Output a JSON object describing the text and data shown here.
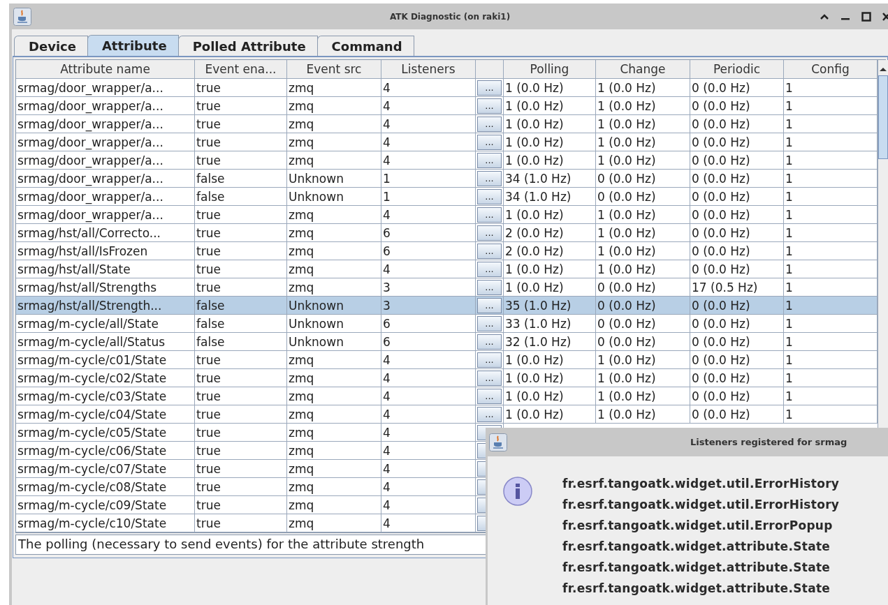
{
  "window": {
    "title": "ATK Diagnostic (on raki1)"
  },
  "tabs": [
    {
      "label": "Device",
      "selected": false
    },
    {
      "label": "Attribute",
      "selected": true
    },
    {
      "label": "Polled Attribute",
      "selected": false
    },
    {
      "label": "Command",
      "selected": false
    }
  ],
  "table": {
    "columns": [
      "Attribute name",
      "Event ena...",
      "Event src",
      "Listeners"
    ],
    "stat_columns": [
      "Polling",
      "Change",
      "Periodic",
      "Config"
    ],
    "rows": [
      {
        "cells": [
          "srmag/door_wrapper/a...",
          "true",
          "zmq",
          "4"
        ],
        "button": "...",
        "stats": [
          "1 (0.0 Hz)",
          "1 (0.0 Hz)",
          "0 (0.0 Hz)",
          "1"
        ],
        "selected": false
      },
      {
        "cells": [
          "srmag/door_wrapper/a...",
          "true",
          "zmq",
          "4"
        ],
        "button": "...",
        "stats": [
          "1 (0.0 Hz)",
          "1 (0.0 Hz)",
          "0 (0.0 Hz)",
          "1"
        ],
        "selected": false
      },
      {
        "cells": [
          "srmag/door_wrapper/a...",
          "true",
          "zmq",
          "4"
        ],
        "button": "...",
        "stats": [
          "1 (0.0 Hz)",
          "1 (0.0 Hz)",
          "0 (0.0 Hz)",
          "1"
        ],
        "selected": false
      },
      {
        "cells": [
          "srmag/door_wrapper/a...",
          "true",
          "zmq",
          "4"
        ],
        "button": "...",
        "stats": [
          "1 (0.0 Hz)",
          "1 (0.0 Hz)",
          "0 (0.0 Hz)",
          "1"
        ],
        "selected": false
      },
      {
        "cells": [
          "srmag/door_wrapper/a...",
          "true",
          "zmq",
          "4"
        ],
        "button": "...",
        "stats": [
          "1 (0.0 Hz)",
          "1 (0.0 Hz)",
          "0 (0.0 Hz)",
          "1"
        ],
        "selected": false
      },
      {
        "cells": [
          "srmag/door_wrapper/a...",
          "false",
          "Unknown",
          "1"
        ],
        "button": "...",
        "stats": [
          "34 (1.0 Hz)",
          "0 (0.0 Hz)",
          "0 (0.0 Hz)",
          "1"
        ],
        "selected": false
      },
      {
        "cells": [
          "srmag/door_wrapper/a...",
          "false",
          "Unknown",
          "1"
        ],
        "button": "...",
        "stats": [
          "34 (1.0 Hz)",
          "0 (0.0 Hz)",
          "0 (0.0 Hz)",
          "1"
        ],
        "selected": false
      },
      {
        "cells": [
          "srmag/door_wrapper/a...",
          "true",
          "zmq",
          "4"
        ],
        "button": "...",
        "stats": [
          "1 (0.0 Hz)",
          "1 (0.0 Hz)",
          "0 (0.0 Hz)",
          "1"
        ],
        "selected": false
      },
      {
        "cells": [
          "srmag/hst/all/Correcto...",
          "true",
          "zmq",
          "6"
        ],
        "button": "...",
        "stats": [
          "2 (0.0 Hz)",
          "1 (0.0 Hz)",
          "0 (0.0 Hz)",
          "1"
        ],
        "selected": false
      },
      {
        "cells": [
          "srmag/hst/all/IsFrozen",
          "true",
          "zmq",
          "6"
        ],
        "button": "...",
        "stats": [
          "2 (0.0 Hz)",
          "1 (0.0 Hz)",
          "0 (0.0 Hz)",
          "1"
        ],
        "selected": false
      },
      {
        "cells": [
          "srmag/hst/all/State",
          "true",
          "zmq",
          "4"
        ],
        "button": "...",
        "stats": [
          "1 (0.0 Hz)",
          "1 (0.0 Hz)",
          "0 (0.0 Hz)",
          "1"
        ],
        "selected": false
      },
      {
        "cells": [
          "srmag/hst/all/Strengths",
          "true",
          "zmq",
          "3"
        ],
        "button": "...",
        "stats": [
          "1 (0.0 Hz)",
          "0 (0.0 Hz)",
          "17 (0.5 Hz)",
          "1"
        ],
        "selected": false
      },
      {
        "cells": [
          "srmag/hst/all/Strength...",
          "false",
          "Unknown",
          "3"
        ],
        "button": "...",
        "stats": [
          "35 (1.0 Hz)",
          "0 (0.0 Hz)",
          "0 (0.0 Hz)",
          "1"
        ],
        "selected": true
      },
      {
        "cells": [
          "srmag/m-cycle/all/State",
          "false",
          "Unknown",
          "6"
        ],
        "button": "...",
        "stats": [
          "33 (1.0 Hz)",
          "0 (0.0 Hz)",
          "0 (0.0 Hz)",
          "1"
        ],
        "selected": false
      },
      {
        "cells": [
          "srmag/m-cycle/all/Status",
          "false",
          "Unknown",
          "6"
        ],
        "button": "...",
        "stats": [
          "32 (1.0 Hz)",
          "0 (0.0 Hz)",
          "0 (0.0 Hz)",
          "1"
        ],
        "selected": false
      },
      {
        "cells": [
          "srmag/m-cycle/c01/State",
          "true",
          "zmq",
          "4"
        ],
        "button": "...",
        "stats": [
          "1 (0.0 Hz)",
          "1 (0.0 Hz)",
          "0 (0.0 Hz)",
          "1"
        ],
        "selected": false
      },
      {
        "cells": [
          "srmag/m-cycle/c02/State",
          "true",
          "zmq",
          "4"
        ],
        "button": "...",
        "stats": [
          "1 (0.0 Hz)",
          "1 (0.0 Hz)",
          "0 (0.0 Hz)",
          "1"
        ],
        "selected": false
      },
      {
        "cells": [
          "srmag/m-cycle/c03/State",
          "true",
          "zmq",
          "4"
        ],
        "button": "...",
        "stats": [
          "1 (0.0 Hz)",
          "1 (0.0 Hz)",
          "0 (0.0 Hz)",
          "1"
        ],
        "selected": false
      },
      {
        "cells": [
          "srmag/m-cycle/c04/State",
          "true",
          "zmq",
          "4"
        ],
        "button": "...",
        "stats": [
          "1 (0.0 Hz)",
          "1 (0.0 Hz)",
          "0 (0.0 Hz)",
          "1"
        ],
        "selected": false
      },
      {
        "cells": [
          "srmag/m-cycle/c05/State",
          "true",
          "zmq",
          "4"
        ],
        "selected": false
      },
      {
        "cells": [
          "srmag/m-cycle/c06/State",
          "true",
          "zmq",
          "4"
        ],
        "selected": false
      },
      {
        "cells": [
          "srmag/m-cycle/c07/State",
          "true",
          "zmq",
          "4"
        ],
        "selected": false
      },
      {
        "cells": [
          "srmag/m-cycle/c08/State",
          "true",
          "zmq",
          "4"
        ],
        "selected": false
      },
      {
        "cells": [
          "srmag/m-cycle/c09/State",
          "true",
          "zmq",
          "4"
        ],
        "selected": false
      },
      {
        "cells": [
          "srmag/m-cycle/c10/State",
          "true",
          "zmq",
          "4"
        ],
        "selected": false
      }
    ]
  },
  "status_text": "The polling (necessary to send events) for the attribute strength",
  "dialog": {
    "title": "Listeners registered for srmag",
    "lines": [
      "fr.esrf.tangoatk.widget.util.ErrorHistory",
      "fr.esrf.tangoatk.widget.util.ErrorHistory",
      "fr.esrf.tangoatk.widget.util.ErrorPopup",
      "fr.esrf.tangoatk.widget.attribute.State",
      "fr.esrf.tangoatk.widget.attribute.State",
      "fr.esrf.tangoatk.widget.attribute.State"
    ]
  }
}
